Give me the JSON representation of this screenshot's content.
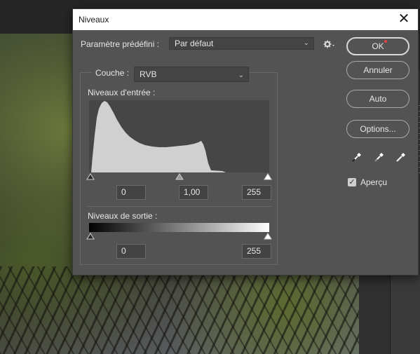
{
  "dialog": {
    "title": "Niveaux",
    "preset_label": "Paramètre prédéfini :",
    "preset_value": "Par défaut",
    "channel_label": "Couche :",
    "channel_value": "RVB",
    "input_levels_label": "Niveaux d'entrée :",
    "input_black": "0",
    "input_gamma": "1,00",
    "input_white": "255",
    "output_levels_label": "Niveaux de sortie :",
    "output_black": "0",
    "output_white": "255",
    "buttons": {
      "ok": "OK",
      "cancel": "Annuler",
      "auto": "Auto",
      "options": "Options..."
    },
    "preview_label": "Aperçu",
    "preview_checked": true,
    "icons": [
      "close-icon",
      "gear-icon",
      "black-eyedropper-icon",
      "gray-eyedropper-icon",
      "white-eyedropper-icon"
    ]
  }
}
